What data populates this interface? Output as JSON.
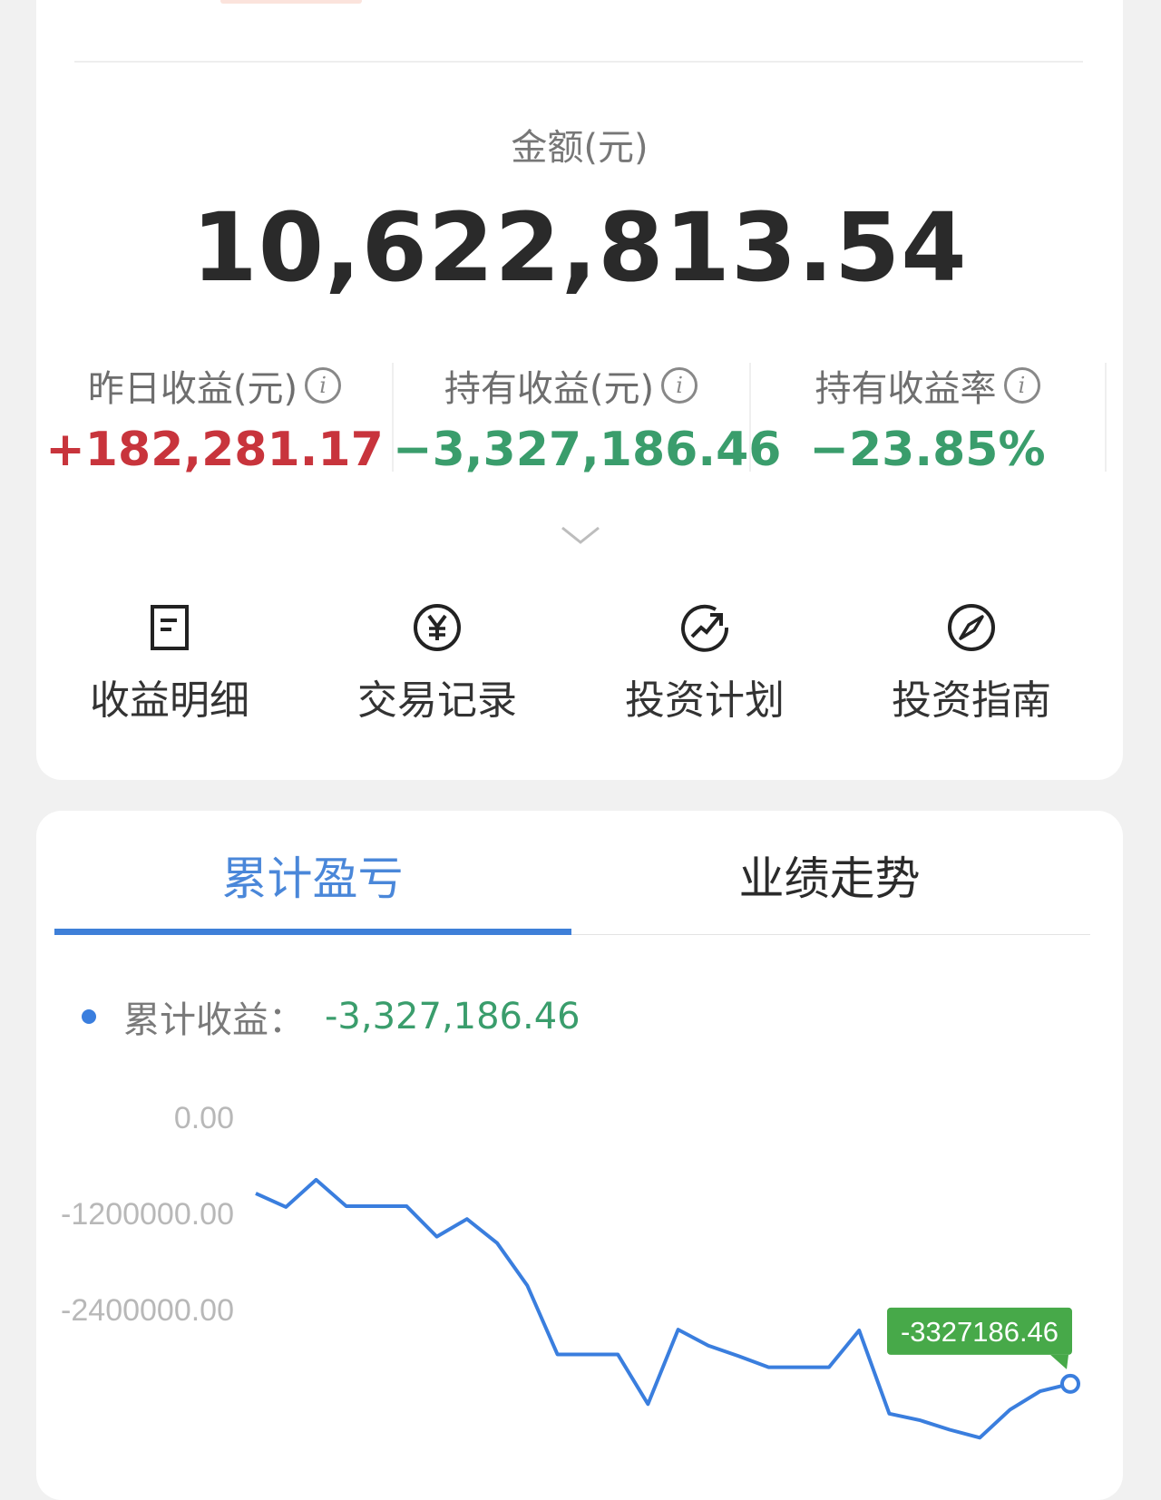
{
  "summary": {
    "amount_label": "金额(元)",
    "amount_value": "10,622,813.54",
    "metrics": [
      {
        "label": "昨日收益(元)",
        "value": "+182,281.17",
        "color": "#c8343c"
      },
      {
        "label": "持有收益(元)",
        "value": "−3,327,186.46",
        "color": "#3a9d6c"
      },
      {
        "label": "持有收益率",
        "value": "−23.85%",
        "color": "#3a9d6c"
      }
    ],
    "info_icon_glyph": "i"
  },
  "actions": [
    {
      "label": "收益明细",
      "icon": "document-icon"
    },
    {
      "label": "交易记录",
      "icon": "yen-circle-icon"
    },
    {
      "label": "投资计划",
      "icon": "trend-circle-icon"
    },
    {
      "label": "投资指南",
      "icon": "compass-icon"
    }
  ],
  "tabs": {
    "active": "累计盈亏",
    "inactive": "业绩走势"
  },
  "legend": {
    "label": "累计收益：",
    "value": "-3,327,186.46"
  },
  "colors": {
    "accent": "#3e7fd8",
    "loss": "#3a9d6c",
    "gain": "#c8343c",
    "tooltip_bg": "#47a949"
  },
  "chart_data": {
    "type": "line",
    "y_tick_labels": [
      "0.00",
      "-1200000.00",
      "-2400000.00"
    ],
    "y_ticks": [
      0,
      -1200000,
      -2400000
    ],
    "ylim": [
      -3600000,
      0
    ],
    "grid": false,
    "series": [
      {
        "values": [
          -950000,
          -1120000,
          -780000,
          -1110000,
          -1110000,
          -1110000,
          -1490000,
          -1270000,
          -1570000,
          -2100000,
          -2960000,
          -2960000,
          -2960000,
          -3580000,
          -2650000,
          -2850000,
          -2980000,
          -3120000,
          -3120000,
          -3120000,
          -2660000,
          -3700000,
          -3780000,
          -3900000,
          -4000000,
          -3650000,
          -3420000,
          -3327186.46
        ]
      }
    ],
    "tooltip_value": "-3327186.46"
  }
}
